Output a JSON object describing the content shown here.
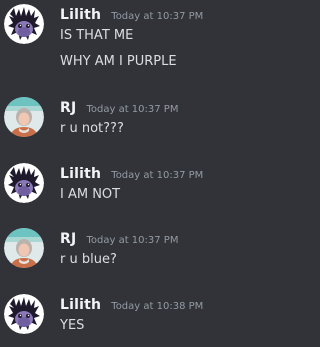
{
  "messages": [
    {
      "username": "Lilith",
      "timestamp": "Today at 10:37 PM",
      "lines": [
        "IS THAT ME",
        "WHY AM I PURPLE"
      ]
    },
    {
      "username": "RJ",
      "timestamp": "Today at 10:37 PM",
      "lines": [
        "r u not???"
      ]
    },
    {
      "username": "Lilith",
      "timestamp": "Today at 10:37 PM",
      "lines": [
        "I AM NOT"
      ]
    },
    {
      "username": "RJ",
      "timestamp": "Today at 10:37 PM",
      "lines": [
        "r u blue?"
      ]
    },
    {
      "username": "Lilith",
      "timestamp": "Today at 10:38 PM",
      "lines": [
        "YES"
      ]
    }
  ],
  "colors": {
    "background": "#313338",
    "username": "#f2f3f5",
    "timestamp": "#949ba4",
    "message_text": "#dbdee1"
  },
  "icons": {
    "lilith_avatar": "purple-creature-avatar-icon",
    "rj_avatar": "person-avatar-icon"
  }
}
